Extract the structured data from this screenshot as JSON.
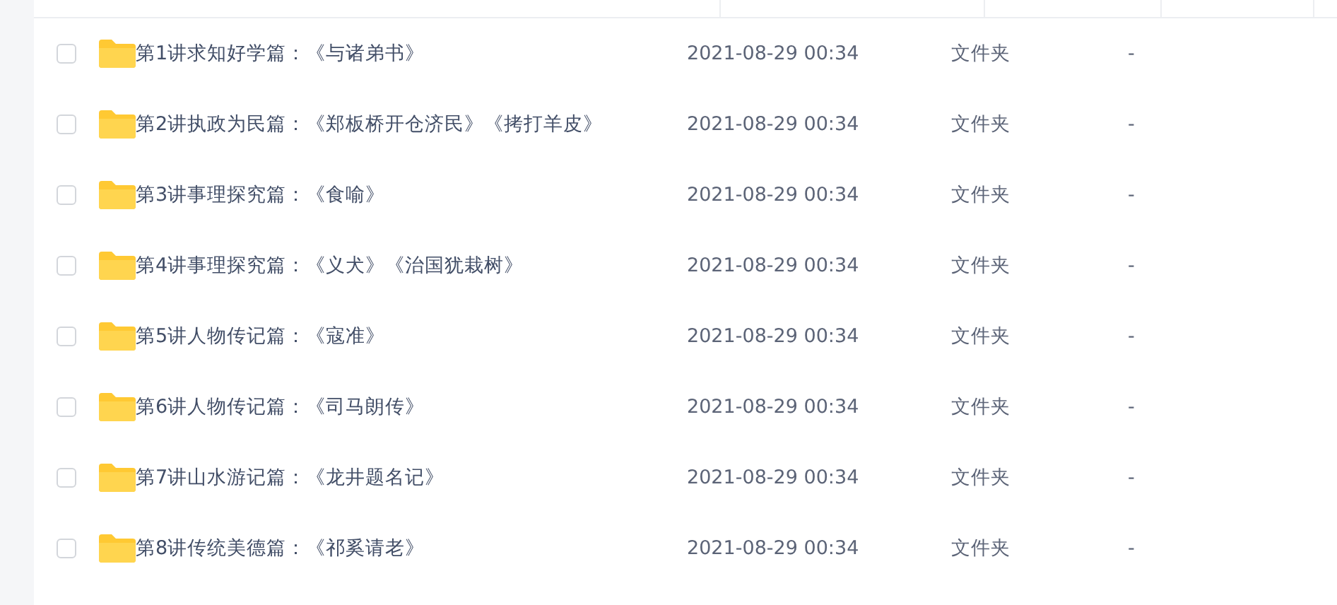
{
  "files": [
    {
      "name": "第1讲求知好学篇：《与诸弟书》",
      "modified": "2021-08-29 00:34",
      "type": "文件夹",
      "size": "-",
      "checked": false
    },
    {
      "name": "第2讲执政为民篇：《郑板桥开仓济民》《拷打羊皮》",
      "modified": "2021-08-29 00:34",
      "type": "文件夹",
      "size": "-",
      "checked": false
    },
    {
      "name": "第3讲事理探究篇：《食喻》",
      "modified": "2021-08-29 00:34",
      "type": "文件夹",
      "size": "-",
      "checked": false
    },
    {
      "name": "第4讲事理探究篇：《义犬》《治国犹栽树》",
      "modified": "2021-08-29 00:34",
      "type": "文件夹",
      "size": "-",
      "checked": false
    },
    {
      "name": "第5讲人物传记篇：《寇准》",
      "modified": "2021-08-29 00:34",
      "type": "文件夹",
      "size": "-",
      "checked": false
    },
    {
      "name": "第6讲人物传记篇：《司马朗传》",
      "modified": "2021-08-29 00:34",
      "type": "文件夹",
      "size": "-",
      "checked": false
    },
    {
      "name": "第7讲山水游记篇：《龙井题名记》",
      "modified": "2021-08-29 00:34",
      "type": "文件夹",
      "size": "-",
      "checked": false
    },
    {
      "name": "第8讲传统美德篇：《祁奚请老》",
      "modified": "2021-08-29 00:34",
      "type": "文件夹",
      "size": "-",
      "checked": false
    }
  ]
}
